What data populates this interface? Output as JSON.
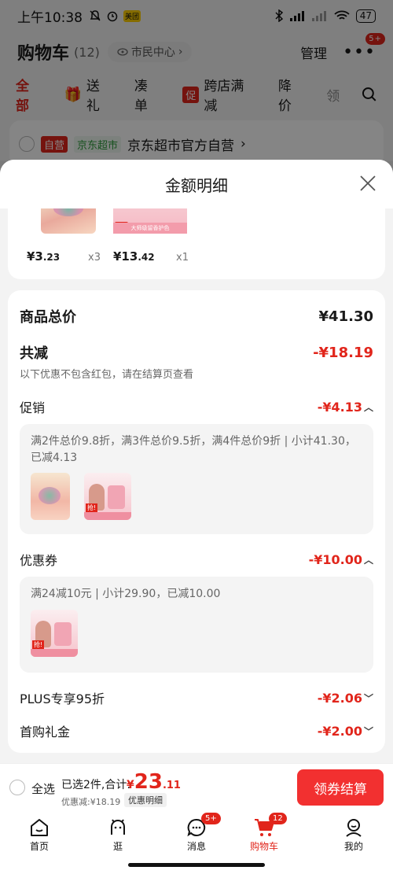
{
  "status_bar": {
    "time": "上午10:38",
    "battery": "47",
    "badge": "美团"
  },
  "cart_header": {
    "title": "购物车",
    "count": "(12)",
    "location": "市民中心",
    "manage": "管理",
    "more_badge": "5+"
  },
  "filters": [
    {
      "label": "全部",
      "active": true
    },
    {
      "label": "送礼"
    },
    {
      "label": "凑单"
    },
    {
      "label": "跨店满减",
      "tag": "促"
    },
    {
      "label": "降价"
    },
    {
      "label": "领"
    }
  ],
  "store": {
    "self_badge": "自营",
    "jd_badge": "京东超市",
    "name": "京东超市官方自营",
    "chevron": "›"
  },
  "sheet": {
    "title": "金额明细",
    "items": [
      {
        "price_int": "¥3",
        "price_dec": ".23",
        "qty": "x3"
      },
      {
        "price_int": "¥13",
        "price_dec": ".42",
        "qty": "x1"
      }
    ],
    "thumb_tag": "抢!",
    "thumb_band": "大师级留香护色",
    "total_label": "商品总价",
    "total_value": "¥41.30",
    "reduce_label": "共减",
    "reduce_value": "-¥18.19",
    "reduce_hint": "以下优惠不包含红包，请在结算页查看",
    "promo": {
      "label": "促销",
      "value": "-¥4.13",
      "detail": "满2件总价9.8折，满3件总价9.5折，满4件总价9折 | 小计41.30，已减4.13"
    },
    "coupon": {
      "label": "优惠券",
      "value": "-¥10.00",
      "detail": "满24减10元 | 小计29.90，已减10.00"
    },
    "plus": {
      "label": "PLUS专享95折",
      "value": "-¥2.06"
    },
    "first": {
      "label": "首购礼金",
      "value": "-¥2.00"
    }
  },
  "checkout": {
    "select_all": "全选",
    "selected": "已选2件,合计:",
    "yen": "¥",
    "amount_int": "23",
    "amount_dec": ".11",
    "saved": "优惠减:¥18.19",
    "detail_btn": "优惠明细",
    "button": "领券结算"
  },
  "nav": [
    {
      "label": "首页",
      "icon": "home-icon"
    },
    {
      "label": "逛",
      "icon": "browse-icon"
    },
    {
      "label": "消息",
      "icon": "message-icon",
      "badge": "5+"
    },
    {
      "label": "购物车",
      "icon": "cart-icon",
      "badge": "12",
      "active": true
    },
    {
      "label": "我的",
      "icon": "profile-icon"
    }
  ],
  "colors": {
    "accent": "#e1251b",
    "button": "#f23030"
  }
}
